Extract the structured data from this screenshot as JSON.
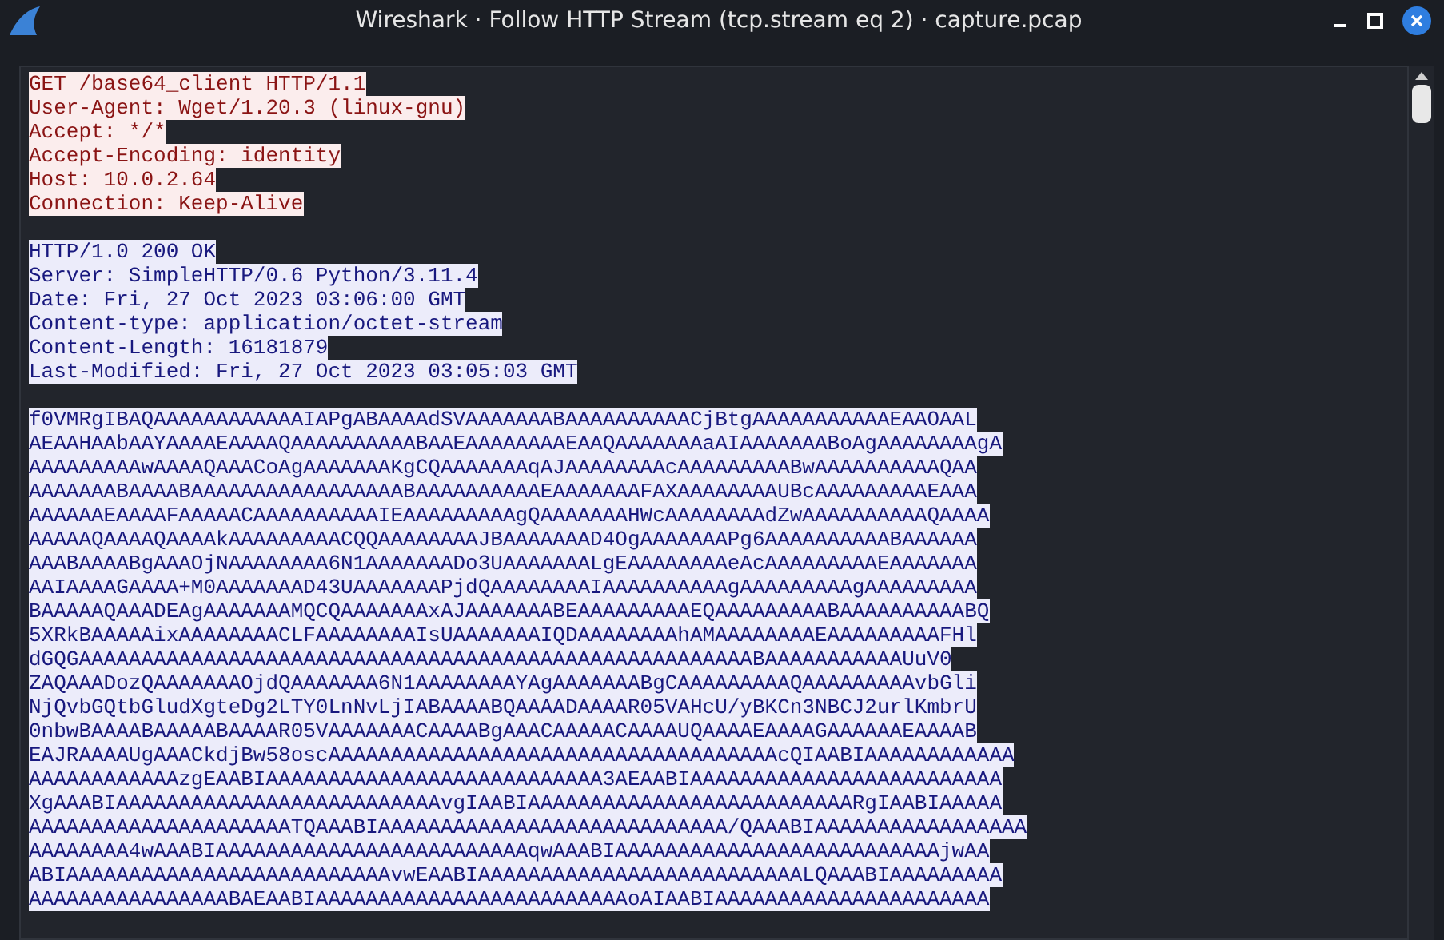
{
  "window": {
    "title": "Wireshark · Follow HTTP Stream (tcp.stream eq 2) · capture.pcap"
  },
  "stream": [
    {
      "kind": "client",
      "lines": [
        "GET /base64_client HTTP/1.1",
        "User-Agent: Wget/1.20.3 (linux-gnu)",
        "Accept: */*",
        "Accept-Encoding: identity",
        "Host: 10.0.2.64",
        "Connection: Keep-Alive"
      ]
    },
    {
      "kind": "server",
      "lines": [
        "HTTP/1.0 200 OK",
        "Server: SimpleHTTP/0.6 Python/3.11.4",
        "Date: Fri, 27 Oct 2023 03:06:00 GMT",
        "Content-type: application/octet-stream",
        "Content-Length: 16181879",
        "Last-Modified: Fri, 27 Oct 2023 03:05:03 GMT"
      ]
    },
    {
      "kind": "server",
      "lines": [
        "f0VMRgIBAQAAAAAAAAAAAAIAPgABAAAAdSVAAAAAAABAAAAAAAAAACjBtgAAAAAAAAAAAEAAOAAL",
        "AEAAHAAbAAYAAAAEAAAAQAAAAAAAAAABAAEAAAAAAAAEAAQAAAAAAAaAIAAAAAAABoAgAAAAAAAAgA",
        "AAAAAAAAAwAAAAQAAACoAgAAAAAAAKgCQAAAAAAAqAJAAAAAAAAcAAAAAAAAABwAAAAAAAAAAQAA",
        "AAAAAAABAAAABAAAAAAAAAAAAAAAAABAAAAAAAAAAEAAAAAAAFAXAAAAAAAAUBcAAAAAAAAAEAAA",
        "AAAAAAEAAAAFAAAAACAAAAAAAAAAIEAAAAAAAAAgQAAAAAAAHWcAAAAAAAAdZwAAAAAAAAAAQAAAA",
        "AAAAAQAAAAQAAAAkAAAAAAAAACQQAAAAAAAAJBAAAAAAAD4OgAAAAAAAPg6AAAAAAAAAABAAAAAA",
        "AAABAAAABgAAAOjNAAAAAAAA6N1AAAAAAADo3UAAAAAAALgEAAAAAAAAeAcAAAAAAAAAEAAAAAAA",
        "AAIAAAAGAAAA+M0AAAAAAAD43UAAAAAAAPjdQAAAAAAAAIAAAAAAAAAAgAAAAAAAAAgAAAAAAAAA",
        "BAAAAAQAAADEAgAAAAAAAMQCQAAAAAAAxAJAAAAAAABEAAAAAAAAAEQAAAAAAAAABAAAAAAAAAABQ",
        "5XRkBAAAAAixAAAAAAAACLFAAAAAAAAIsUAAAAAAAIQDAAAAAAAAhAMAAAAAAAAEAAAAAAAAAFHl",
        "dGQGAAAAAAAAAAAAAAAAAAAAAAAAAAAAAAAAAAAAAAAAAAAAAAAAAAAAAABAAAAAAAAAAAUuV0",
        "ZAQAAADozQAAAAAAAOjdQAAAAAAA6N1AAAAAAAAYAgAAAAAAABgCAAAAAAAAAQAAAAAAAAAvbGli",
        "NjQvbGQtbGludXgteDg2LTY0LnNvLjIABAAAABQAAAADAAAAR05VAHcU/yBKCn3NBCJ2urlKmbrU",
        "0nbwBAAAABAAAAABAAAAR05VAAAAAAACAAAABgAAACAAAAACAAAAUQAAAAEAAAAGAAAAAAEAAAAB",
        "EAJRAAAAUgAAACkdjBw58oscAAAAAAAAAAAAAAAAAAAAAAAAAAAAAAAAAAAAcQIAABIAAAAAAAAAAAA",
        "AAAAAAAAAAAAzgEAABIAAAAAAAAAAAAAAAAAAAAAAAAAAA3AEAABIAAAAAAAAAAAAAAAAAAAAAAAAA",
        "XgAAABIAAAAAAAAAAAAAAAAAAAAAAAAAAvgIAABIAAAAAAAAAAAAAAAAAAAAAAAAAARgIAABIAAAAA",
        "AAAAAAAAAAAAAAAAAAAAATQAAABIAAAAAAAAAAAAAAAAAAAAAAAAAAAA/QAAABIAAAAAAAAAAAAAAAAA",
        "AAAAAAAA4wAAABIAAAAAAAAAAAAAAAAAAAAAAAAAqwAAABIAAAAAAAAAAAAAAAAAAAAAAAAAAjwAA",
        "ABIAAAAAAAAAAAAAAAAAAAAAAAAAAvwEAABIAAAAAAAAAAAAAAAAAAAAAAAAAALQAAABIAAAAAAAAA",
        "AAAAAAAAAAAAAAAABAEAABIAAAAAAAAAAAAAAAAAAAAAAAAAoAIAABIAAAAAAAAAAAAAAAAAAAAAA"
      ]
    }
  ]
}
